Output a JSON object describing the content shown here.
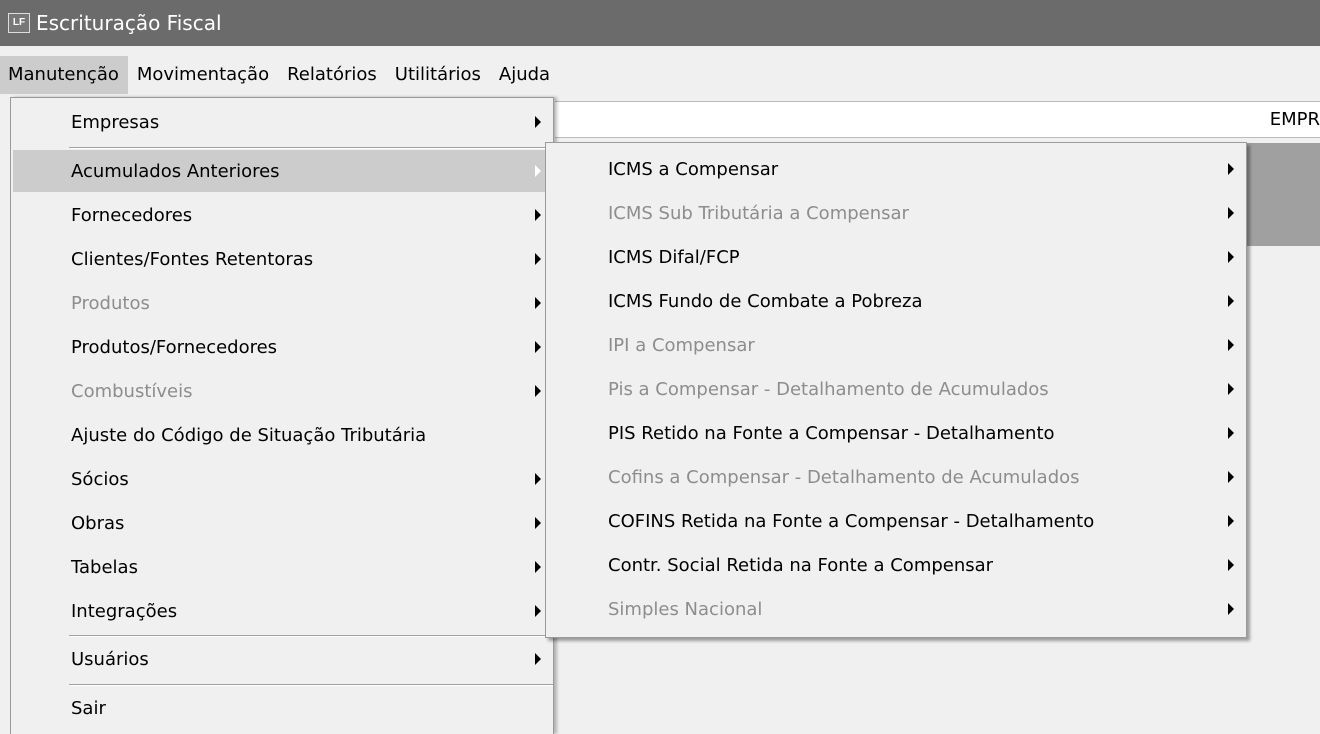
{
  "window": {
    "icon_text": "LF",
    "title": "Escrituração Fiscal"
  },
  "menubar": {
    "items": [
      "Manutenção",
      "Movimentação",
      "Relatórios",
      "Utilitários",
      "Ajuda"
    ]
  },
  "background": {
    "empr_label": "EMPR"
  },
  "main_menu": {
    "items": [
      {
        "label": "Empresas"
      },
      {
        "label": "Acumulados Anteriores"
      },
      {
        "label": "Fornecedores"
      },
      {
        "label": "Clientes/Fontes Retentoras"
      },
      {
        "label": "Produtos"
      },
      {
        "label": "Produtos/Fornecedores"
      },
      {
        "label": "Combustíveis"
      },
      {
        "label": "Ajuste do Código de Situação Tributária"
      },
      {
        "label": "Sócios"
      },
      {
        "label": "Obras"
      },
      {
        "label": "Tabelas"
      },
      {
        "label": "Integrações"
      },
      {
        "label": "Usuários"
      },
      {
        "label": "Sair"
      }
    ]
  },
  "sub_menu": {
    "items": [
      {
        "label": "ICMS a Compensar"
      },
      {
        "label": "ICMS Sub Tributária a Compensar"
      },
      {
        "label": "ICMS Difal/FCP"
      },
      {
        "label": "ICMS Fundo de Combate a Pobreza"
      },
      {
        "label": "IPI a Compensar"
      },
      {
        "label": "Pis a Compensar - Detalhamento de Acumulados"
      },
      {
        "label": "PIS Retido na Fonte a Compensar - Detalhamento"
      },
      {
        "label": "Cofins a Compensar - Detalhamento de Acumulados"
      },
      {
        "label": "COFINS Retida na Fonte a Compensar - Detalhamento"
      },
      {
        "label": "Contr. Social Retida na Fonte a Compensar"
      },
      {
        "label": "Simples Nacional"
      }
    ]
  },
  "colors": {
    "titlebar": "#6b6b6b",
    "menu_bg": "#f0f0f0",
    "highlight": "#cccccc",
    "disabled_text": "#8d8d8d"
  }
}
